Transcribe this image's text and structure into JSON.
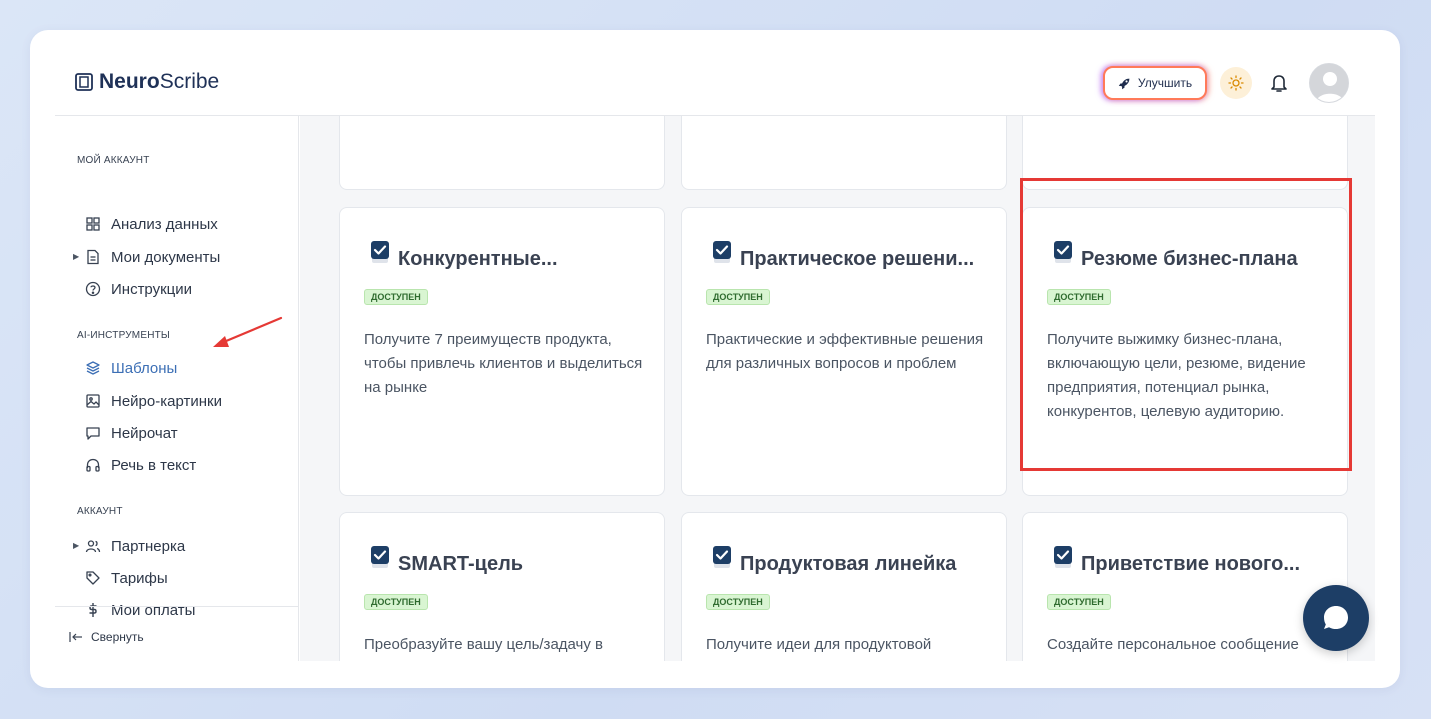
{
  "brand": {
    "bold": "Neuro",
    "light": "Scribe"
  },
  "header": {
    "upgrade_label": "Улучшить"
  },
  "sidebar": {
    "sections": [
      {
        "label": "МОЙ АККАУНТ"
      },
      {
        "label": "AI-ИНСТРУМЕНТЫ"
      },
      {
        "label": "АККАУНТ"
      }
    ],
    "items": [
      {
        "label": "Анализ данных",
        "icon": "grid-icon"
      },
      {
        "label": "Мои документы",
        "icon": "document-icon",
        "expandable": true
      },
      {
        "label": "Инструкции",
        "icon": "help-circle-icon"
      },
      {
        "label": "Шаблоны",
        "icon": "layers-icon",
        "active": true
      },
      {
        "label": "Нейро-картинки",
        "icon": "image-icon"
      },
      {
        "label": "Нейрочат",
        "icon": "chat-icon"
      },
      {
        "label": "Речь в текст",
        "icon": "headphones-icon"
      },
      {
        "label": "Партнерка",
        "icon": "users-icon",
        "expandable": true
      },
      {
        "label": "Тарифы",
        "icon": "tag-icon"
      },
      {
        "label": "Мои оплаты",
        "icon": "dollar-icon"
      }
    ],
    "collapse_label": "Свернуть"
  },
  "cards": [
    {
      "title": "Конкурентные...",
      "badge": "ДОСТУПЕН",
      "description": "Получите 7 преимуществ продукта, чтобы привлечь клиентов и выделиться на рынке"
    },
    {
      "title": "Практическое решени...",
      "badge": "ДОСТУПЕН",
      "description": "Практические и эффективные решения для различных вопросов и проблем"
    },
    {
      "title": "Резюме бизнес-плана",
      "badge": "ДОСТУПЕН",
      "description": "Получите выжимку бизнес-плана, включающую цели, резюме, видение предприятия, потенциал рынка, конкурентов, целевую аудиторию."
    },
    {
      "title": "SMART-цель",
      "badge": "ДОСТУПЕН",
      "description": "Преобразуйте вашу цель/задачу в SMART-цель с использованием системы OKR (Objective and Key"
    },
    {
      "title": "Продуктовая линейка",
      "badge": "ДОСТУПЕН",
      "description": "Получите идеи для продуктовой линейки, такие как бесплатный продукт, лид-магнит, трипваер и т.д."
    },
    {
      "title": "Приветствие нового...",
      "badge": "ДОСТУПЕН",
      "description": "Создайте персональное сообщение для нового сотрудника, чтобы поприветствовать его в команде и"
    }
  ],
  "colors": {
    "accent": "#3c6fb5",
    "badge_bg": "#d9f5d2",
    "highlight": "#e53935",
    "chat": "#1d3e66"
  }
}
